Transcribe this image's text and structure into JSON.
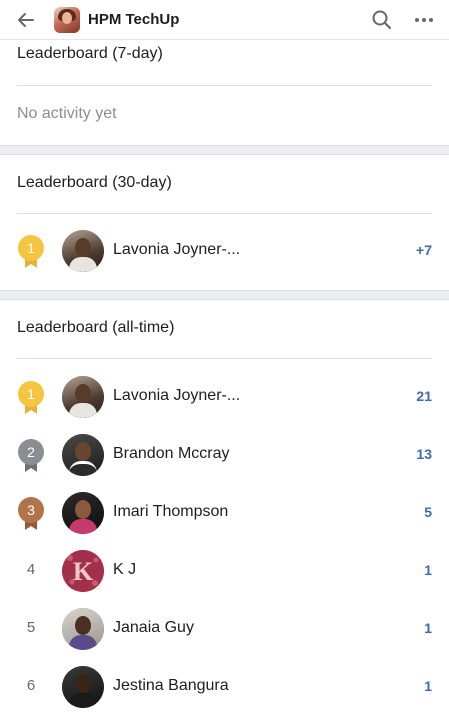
{
  "header": {
    "title": "HPM TechUp",
    "back_icon": "arrow-left-icon",
    "search_icon": "search-icon",
    "more_icon": "more-dots-icon"
  },
  "leaderboard_7day": {
    "title": "Leaderboard (7-day)",
    "empty_text": "No activity yet"
  },
  "leaderboard_30day": {
    "title": "Leaderboard (30-day)",
    "rows": [
      {
        "rank": "1",
        "name": "Lavonia Joyner-...",
        "points": "+7"
      }
    ]
  },
  "leaderboard_alltime": {
    "title": "Leaderboard (all-time)",
    "rows": [
      {
        "rank": "1",
        "name": "Lavonia Joyner-...",
        "points": "21"
      },
      {
        "rank": "2",
        "name": "Brandon Mccray",
        "points": "13"
      },
      {
        "rank": "3",
        "name": "Imari Thompson",
        "points": "5"
      },
      {
        "rank": "4",
        "name": "K J",
        "points": "1"
      },
      {
        "rank": "5",
        "name": "Janaia Guy",
        "points": "1"
      },
      {
        "rank": "6",
        "name": "Jestina Bangura",
        "points": "1"
      }
    ]
  },
  "colors": {
    "gold": "#f5c542",
    "silver": "#8a8d91",
    "bronze": "#b0734a",
    "points": "#4267b2"
  }
}
